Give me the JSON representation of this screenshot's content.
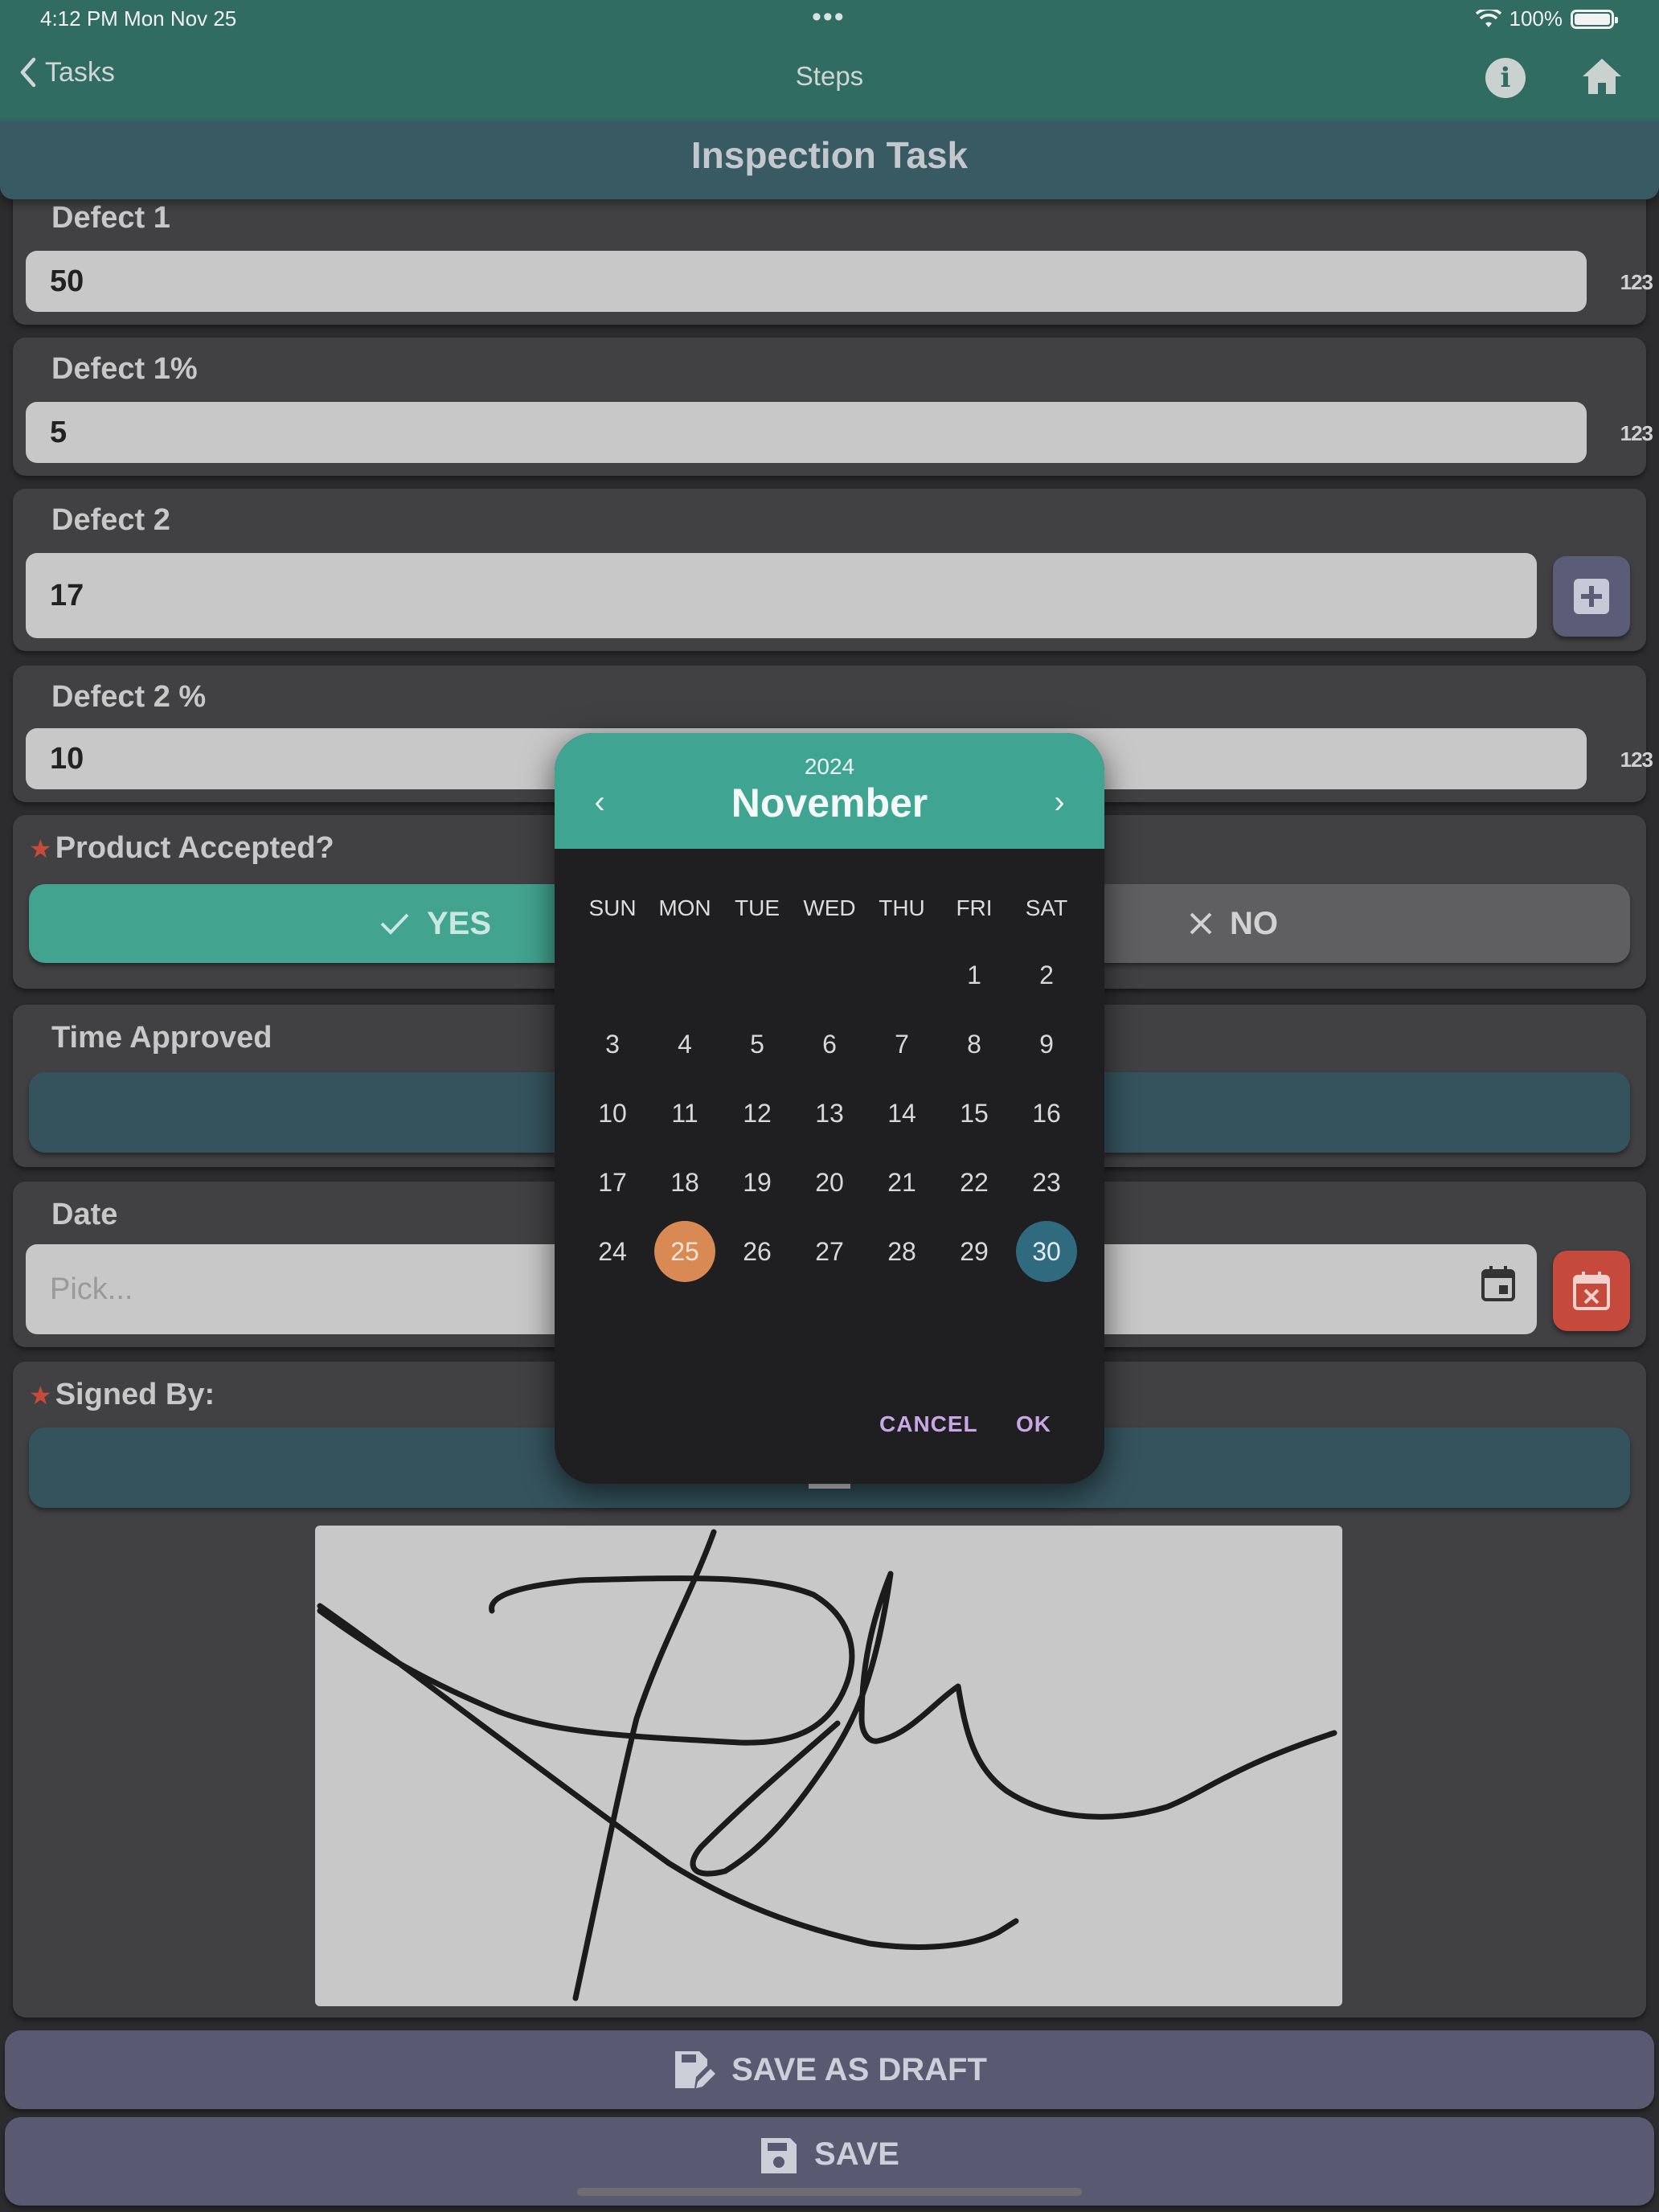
{
  "status": {
    "time": "4:12 PM   Mon Nov 25",
    "dots": "•••",
    "battery": "100%"
  },
  "nav": {
    "back_label": "Tasks",
    "title": "Steps"
  },
  "task": {
    "title": "Inspection Task"
  },
  "fields": {
    "defect1": {
      "label": "Defect 1",
      "value": "50",
      "badge": "123"
    },
    "defect1_pct": {
      "label": "Defect 1%",
      "value": "5",
      "badge": "123"
    },
    "defect2": {
      "label": "Defect 2",
      "value": "17"
    },
    "defect2_pct": {
      "label": "Defect 2 %",
      "value": "10",
      "badge": "123"
    },
    "product_accepted": {
      "label": "Product Accepted?",
      "yes": "YES",
      "no": "NO",
      "selected": "YES"
    },
    "time_approved": {
      "label": "Time Approved"
    },
    "date": {
      "label": "Date",
      "placeholder": "Pick..."
    },
    "signed_by": {
      "label": "Signed By:"
    }
  },
  "actions": {
    "save_draft": "SAVE AS DRAFT",
    "save": "SAVE"
  },
  "date_picker": {
    "year": "2024",
    "month": "November",
    "weekdays": [
      "SUN",
      "MON",
      "TUE",
      "WED",
      "THU",
      "FRI",
      "SAT"
    ],
    "first_weekday_index": 5,
    "days_in_month": 30,
    "today": 25,
    "selected": 30,
    "cancel": "CANCEL",
    "ok": "OK"
  },
  "colors": {
    "accent": "#3fa592",
    "today": "#d98a54",
    "selected": "#306a7e",
    "danger": "#c64a3c"
  }
}
